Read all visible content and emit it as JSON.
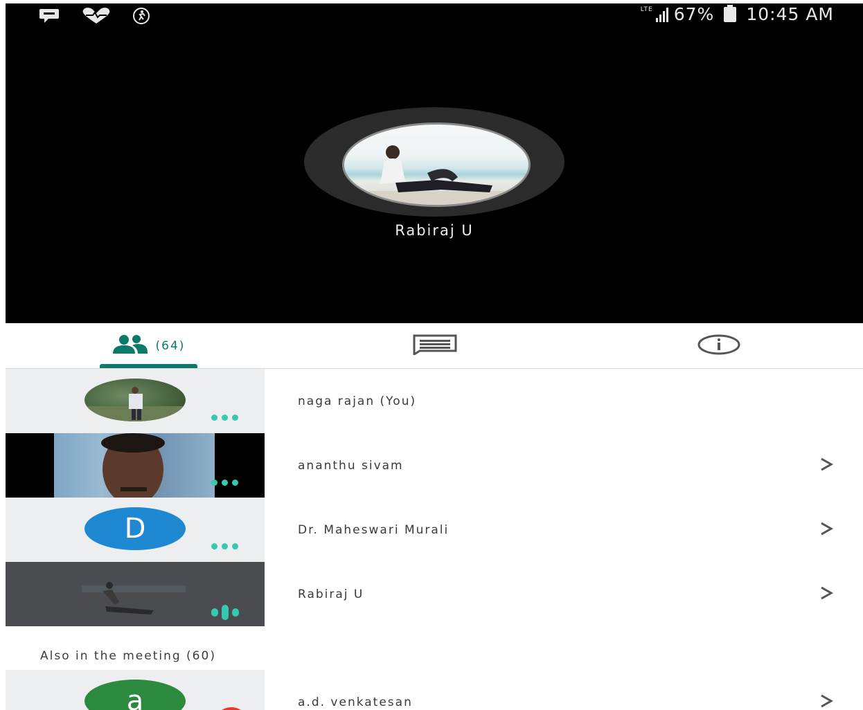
{
  "status_bar": {
    "network": "LTE",
    "battery": "67%",
    "time": "10:45 AM"
  },
  "active_speaker": {
    "name": "Rabiraj U"
  },
  "tabs": {
    "people_count": "(64)"
  },
  "participants": [
    {
      "name": "naga rajan (You)",
      "indicator": "dots"
    },
    {
      "name": "ananthu sivam",
      "indicator": "dots"
    },
    {
      "name": "Dr. Maheswari Murali",
      "avatar_letter": "D",
      "avatar_color": "#1e88d2",
      "indicator": "dots"
    },
    {
      "name": "Rabiraj U",
      "indicator": "speaking"
    }
  ],
  "also_in_meeting": {
    "label": "Also in the meeting (60)",
    "participants": [
      {
        "name": "a.d. venkatesan",
        "avatar_letter": "a",
        "avatar_color": "#2c8a3e"
      }
    ]
  },
  "colors": {
    "accent": "#0b7a66",
    "indicator": "#35c9b2"
  }
}
